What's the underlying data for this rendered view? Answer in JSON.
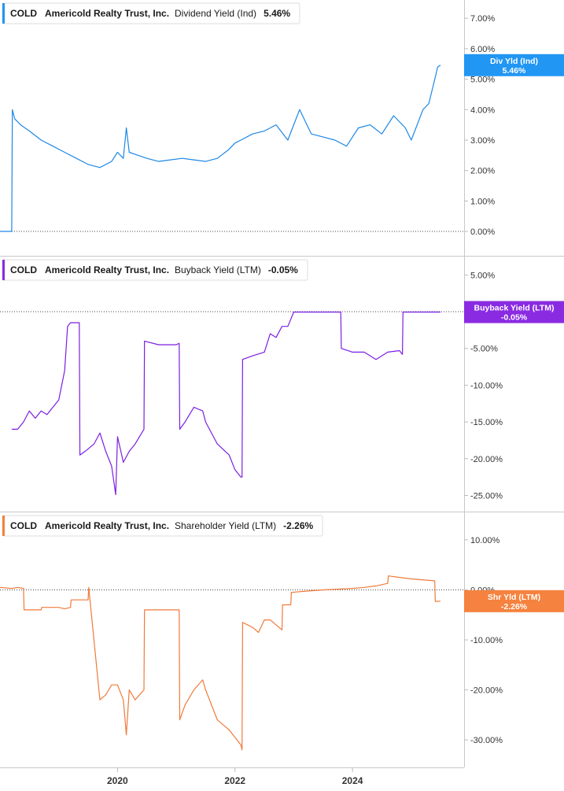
{
  "chart_data": [
    {
      "type": "line",
      "ticker": "COLD",
      "company": "Americold Realty Trust, Inc.",
      "metric": "Dividend Yield (Ind)",
      "current": "5.46%",
      "tag_line1": "Div Yld (Ind)",
      "tag_line2": "5.46%",
      "color": "#1e88e5",
      "tag_color": "#2196f3",
      "ylim": [
        -0.8,
        7.6
      ],
      "yticks": [
        "7.00%",
        "6.00%",
        "5.00%",
        "4.00%",
        "3.00%",
        "2.00%",
        "1.00%",
        "0.00%"
      ],
      "ytick_values": [
        7,
        6,
        5,
        4,
        3,
        2,
        1,
        0
      ],
      "reference_line": 0,
      "current_value": 5.46,
      "series": [
        {
          "x": [
            2018.0,
            2018.2,
            2018.21,
            2018.25,
            2018.35,
            2018.5,
            2018.7,
            2018.9,
            2019.1,
            2019.3,
            2019.5,
            2019.7,
            2019.9,
            2020.0,
            2020.1,
            2020.15,
            2020.2,
            2020.35,
            2020.5,
            2020.7,
            2020.9,
            2021.1,
            2021.3,
            2021.5,
            2021.7,
            2021.9,
            2022.0,
            2022.1,
            2022.3,
            2022.5,
            2022.7,
            2022.9,
            2023.0,
            2023.1,
            2023.3,
            2023.5,
            2023.7,
            2023.9,
            2024.1,
            2024.3,
            2024.5,
            2024.7,
            2024.9,
            2025.0,
            2025.1,
            2025.2,
            2025.3,
            2025.4,
            2025.45,
            2025.5
          ],
          "values": [
            0,
            0,
            4.0,
            3.7,
            3.5,
            3.3,
            3.0,
            2.8,
            2.6,
            2.4,
            2.2,
            2.1,
            2.3,
            2.6,
            2.4,
            3.4,
            2.6,
            2.5,
            2.4,
            2.3,
            2.35,
            2.4,
            2.35,
            2.3,
            2.4,
            2.7,
            2.9,
            3.0,
            3.2,
            3.3,
            3.5,
            3.0,
            3.5,
            4.0,
            3.2,
            3.1,
            3.0,
            2.8,
            3.4,
            3.5,
            3.2,
            3.8,
            3.4,
            3.0,
            3.5,
            4.0,
            4.2,
            5.0,
            5.4,
            5.46
          ]
        }
      ]
    },
    {
      "type": "line",
      "ticker": "COLD",
      "company": "Americold Realty Trust, Inc.",
      "metric": "Buyback Yield (LTM)",
      "current": "-0.05%",
      "tag_line1": "Buyback Yield (LTM)",
      "tag_line2": "-0.05%",
      "color": "#7b1fe0",
      "tag_color": "#8a2be2",
      "ylim": [
        -27.2,
        7.5
      ],
      "yticks": [
        "5.00%",
        "-5.00%",
        "-10.00%",
        "-15.00%",
        "-20.00%",
        "-25.00%"
      ],
      "ytick_values": [
        5,
        -5,
        -10,
        -15,
        -20,
        -25
      ],
      "reference_line": 0,
      "current_value": -0.05,
      "series": [
        {
          "x": [
            2018.2,
            2018.3,
            2018.4,
            2018.5,
            2018.6,
            2018.7,
            2018.8,
            2019.0,
            2019.1,
            2019.15,
            2019.2,
            2019.35,
            2019.36,
            2019.45,
            2019.6,
            2019.7,
            2019.8,
            2019.9,
            2019.97,
            2020.0,
            2020.1,
            2020.2,
            2020.3,
            2020.45,
            2020.46,
            2020.7,
            2021.0,
            2021.05,
            2021.06,
            2021.15,
            2021.3,
            2021.45,
            2021.5,
            2021.7,
            2021.9,
            2022.0,
            2022.1,
            2022.12,
            2022.13,
            2022.3,
            2022.5,
            2022.6,
            2022.7,
            2022.8,
            2022.9,
            2023.0,
            2023.5,
            2023.8,
            2023.81,
            2024.0,
            2024.2,
            2024.4,
            2024.6,
            2024.8,
            2024.85,
            2024.86,
            2025.0,
            2025.5
          ],
          "values": [
            -16,
            -16,
            -15,
            -13.5,
            -14.5,
            -13.5,
            -14,
            -12,
            -8,
            -2,
            -1.5,
            -1.5,
            -19.5,
            -19,
            -18,
            -16.5,
            -19,
            -21,
            -24.9,
            -17,
            -20.5,
            -19,
            -18,
            -16,
            -4,
            -4.5,
            -4.5,
            -4.3,
            -16,
            -15,
            -13,
            -13.5,
            -15,
            -18,
            -19.5,
            -21.5,
            -22.5,
            -22.5,
            -6.5,
            -6,
            -5.5,
            -3,
            -3.5,
            -2,
            -2,
            -0.05,
            -0.05,
            -0.05,
            -5,
            -5.5,
            -5.5,
            -6.5,
            -5.5,
            -5.3,
            -5.8,
            -0.05,
            -0.05,
            -0.05
          ]
        }
      ]
    },
    {
      "type": "line",
      "ticker": "COLD",
      "company": "Americold Realty Trust, Inc.",
      "metric": "Shareholder Yield (LTM)",
      "current": "-2.26%",
      "tag_line1": "Shr Yld (LTM)",
      "tag_line2": "-2.26%",
      "color": "#f07a3a",
      "tag_color": "#f5823e",
      "ylim": [
        -35.5,
        15.5
      ],
      "yticks": [
        "10.00%",
        "0.00%",
        "-10.00%",
        "-20.00%",
        "-30.00%"
      ],
      "ytick_values": [
        10,
        0,
        -10,
        -20,
        -30
      ],
      "reference_line": 0,
      "current_value": -2.26,
      "series": [
        {
          "x": [
            2018.0,
            2018.2,
            2018.3,
            2018.4,
            2018.41,
            2018.6,
            2018.7,
            2018.71,
            2019.0,
            2019.1,
            2019.2,
            2019.21,
            2019.5,
            2019.51,
            2019.7,
            2019.8,
            2019.9,
            2020.0,
            2020.1,
            2020.15,
            2020.2,
            2020.3,
            2020.45,
            2020.46,
            2020.7,
            2021.05,
            2021.06,
            2021.15,
            2021.3,
            2021.45,
            2021.5,
            2021.7,
            2021.9,
            2022.1,
            2022.12,
            2022.13,
            2022.3,
            2022.4,
            2022.5,
            2022.6,
            2022.8,
            2022.81,
            2022.95,
            2022.96,
            2023.5,
            2024.0,
            2024.2,
            2024.4,
            2024.6,
            2024.61,
            2024.8,
            2025.0,
            2025.4,
            2025.41,
            2025.5
          ],
          "values": [
            0.5,
            0.3,
            0.5,
            0.3,
            -4,
            -4,
            -4,
            -3.5,
            -3.5,
            -3.8,
            -3.5,
            -2,
            -2,
            0.5,
            -22,
            -21,
            -19,
            -19,
            -22,
            -29,
            -20,
            -22,
            -20,
            -4,
            -4,
            -4,
            -26,
            -23,
            -20,
            -18,
            -20,
            -26,
            -28,
            -31,
            -32,
            -6.5,
            -7.5,
            -8.5,
            -6,
            -6,
            -8,
            -3,
            -3,
            -0.5,
            0,
            0.3,
            0.5,
            0.8,
            1.3,
            2.8,
            2.5,
            2.2,
            1.8,
            -2.3,
            -2.26
          ]
        }
      ]
    }
  ],
  "x_axis": {
    "range": [
      2018.0,
      2025.9
    ],
    "ticks": [
      2020,
      2022,
      2024
    ],
    "labels": [
      "2020",
      "2022",
      "2024"
    ]
  }
}
